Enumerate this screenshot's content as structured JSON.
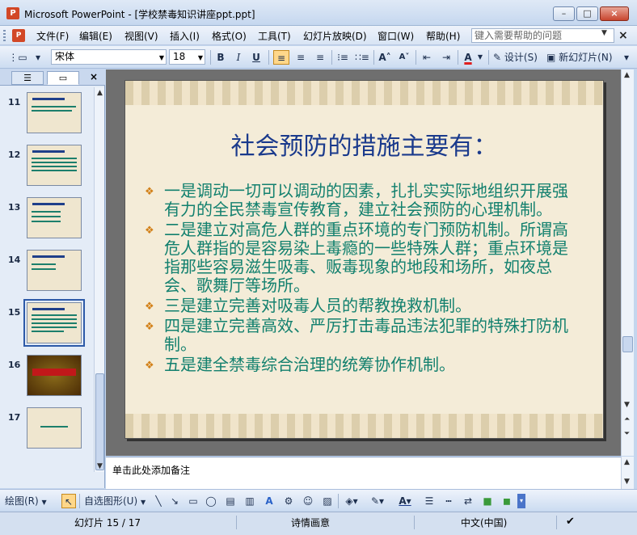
{
  "window": {
    "title": "Microsoft PowerPoint - [学校禁毒知识讲座ppt.ppt]",
    "min_label": "–",
    "max_label": "□",
    "close_label": "×"
  },
  "menu": {
    "items": [
      {
        "label": "文件(F)"
      },
      {
        "label": "编辑(E)"
      },
      {
        "label": "视图(V)"
      },
      {
        "label": "插入(I)"
      },
      {
        "label": "格式(O)"
      },
      {
        "label": "工具(T)"
      },
      {
        "label": "幻灯片放映(D)"
      },
      {
        "label": "窗口(W)"
      },
      {
        "label": "帮助(H)"
      }
    ],
    "help_placeholder": "键入需要帮助的问题",
    "close_doc": "×"
  },
  "toolbar": {
    "font": "宋体",
    "size": "18",
    "bold": "B",
    "italic": "I",
    "underline": "U",
    "font_color": "A",
    "design_label": "设计(S)",
    "new_slide_label": "新幻灯片(N)"
  },
  "panel": {
    "tab_outline": "☰",
    "tab_slides": "▭",
    "close": "×",
    "slides": [
      {
        "num": "11"
      },
      {
        "num": "12"
      },
      {
        "num": "13"
      },
      {
        "num": "14"
      },
      {
        "num": "15"
      },
      {
        "num": "16"
      },
      {
        "num": "17"
      }
    ],
    "selected": "15"
  },
  "slide": {
    "title": "社会预防的措施主要有：",
    "bullets": [
      "一是调动一切可以调动的因素，扎扎实实际地组织开展强有力的全民禁毒宣传教育，建立社会预防的心理机制。",
      "二是建立对高危人群的重点环境的专门预防机制。所谓高危人群指的是容易染上毒瘾的一些特殊人群；重点环境是指那些容易滋生吸毒、贩毒现象的地段和场所，如夜总会、歌舞厅等场所。",
      "三是建立完善对吸毒人员的帮教挽救机制。",
      "四是建立完善高效、严厉打击毒品违法犯罪的特殊打防机制。",
      "五是建全禁毒综合治理的统筹协作机制。"
    ]
  },
  "notes": {
    "placeholder": "单击此处添加备注"
  },
  "drawbar": {
    "draw_label": "绘图(R)",
    "autoshapes_label": "自选图形(U)"
  },
  "status": {
    "slide_info": "幻灯片 15 / 17",
    "design": "诗情画意",
    "language": "中文(中国)"
  },
  "colors": {
    "title_color": "#1a3a8c",
    "body_color": "#12806e",
    "bullet_color": "#d28018"
  }
}
